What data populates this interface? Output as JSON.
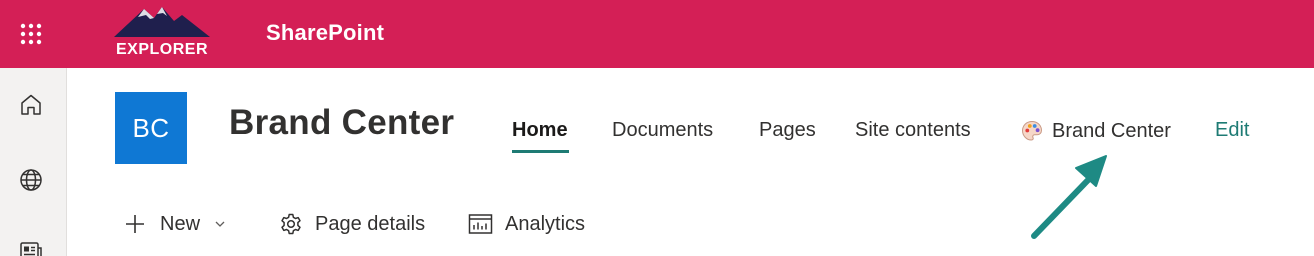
{
  "suite_bar": {
    "background": "#d41f56",
    "app_launcher_icon": "waffle-grid-icon",
    "logo_text": "EXPLORER",
    "app_name": "SharePoint"
  },
  "app_bar": {
    "items": [
      {
        "icon": "home-icon"
      },
      {
        "icon": "globe-icon"
      },
      {
        "icon": "news-icon"
      }
    ]
  },
  "site": {
    "logo_initials": "BC",
    "logo_color": "#0f78d4",
    "title": "Brand Center"
  },
  "nav": {
    "items": [
      {
        "label": "Home",
        "active": true
      },
      {
        "label": "Documents"
      },
      {
        "label": "Pages"
      },
      {
        "label": "Site contents"
      },
      {
        "label": "Brand Center",
        "icon": "palette-icon"
      }
    ],
    "edit_label": "Edit",
    "accent": "#1e7b74"
  },
  "command_bar": {
    "new_label": "New",
    "page_details_label": "Page details",
    "analytics_label": "Analytics"
  },
  "annotation": {
    "arrow_color": "#1e8a84"
  }
}
